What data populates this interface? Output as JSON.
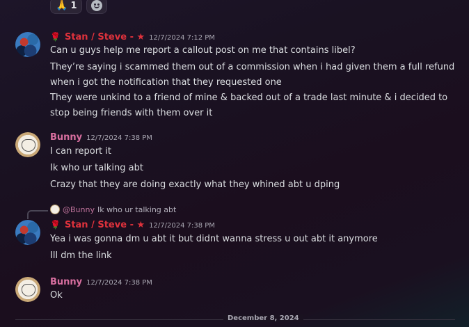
{
  "reactions": [
    {
      "emoji": "🙏",
      "count": "1"
    },
    {
      "emoji": "add-reaction-icon",
      "count": ""
    }
  ],
  "messages": [
    {
      "author": "Stan / Steve - ★",
      "timestamp": "12/7/2024 7:12 PM",
      "lines": [
        "Can u guys help me report a callout post on me that contains libel?",
        "They’re saying i scammed them out of a commission when i had given them a full refund when i got the notification that they requested one",
        "They were unkind to a friend of mine & backed out of a trade last minute & i decided to stop being friends with them over it"
      ]
    },
    {
      "author": "Bunny",
      "timestamp": "12/7/2024 7:38 PM",
      "lines": [
        "I can report it",
        "Ik who ur talking abt",
        "Crazy that they are doing exactly what they whined abt u dping"
      ]
    },
    {
      "reply": {
        "mention": "@Bunny",
        "text": "Ik who ur talking abt"
      },
      "author": "Stan / Steve - ★",
      "timestamp": "12/7/2024 7:38 PM",
      "lines": [
        "Yea i was gonna dm u abt it but didnt wanna stress u out abt it anymore",
        "Ill dm the link"
      ]
    },
    {
      "author": "Bunny",
      "timestamp": "12/7/2024 7:38 PM",
      "lines": [
        "Ok"
      ]
    }
  ],
  "date_divider": "December 8, 2024",
  "colors": {
    "stan_name": "#e0323c",
    "bunny_name": "#d96fa0",
    "text": "#dbdee1"
  }
}
